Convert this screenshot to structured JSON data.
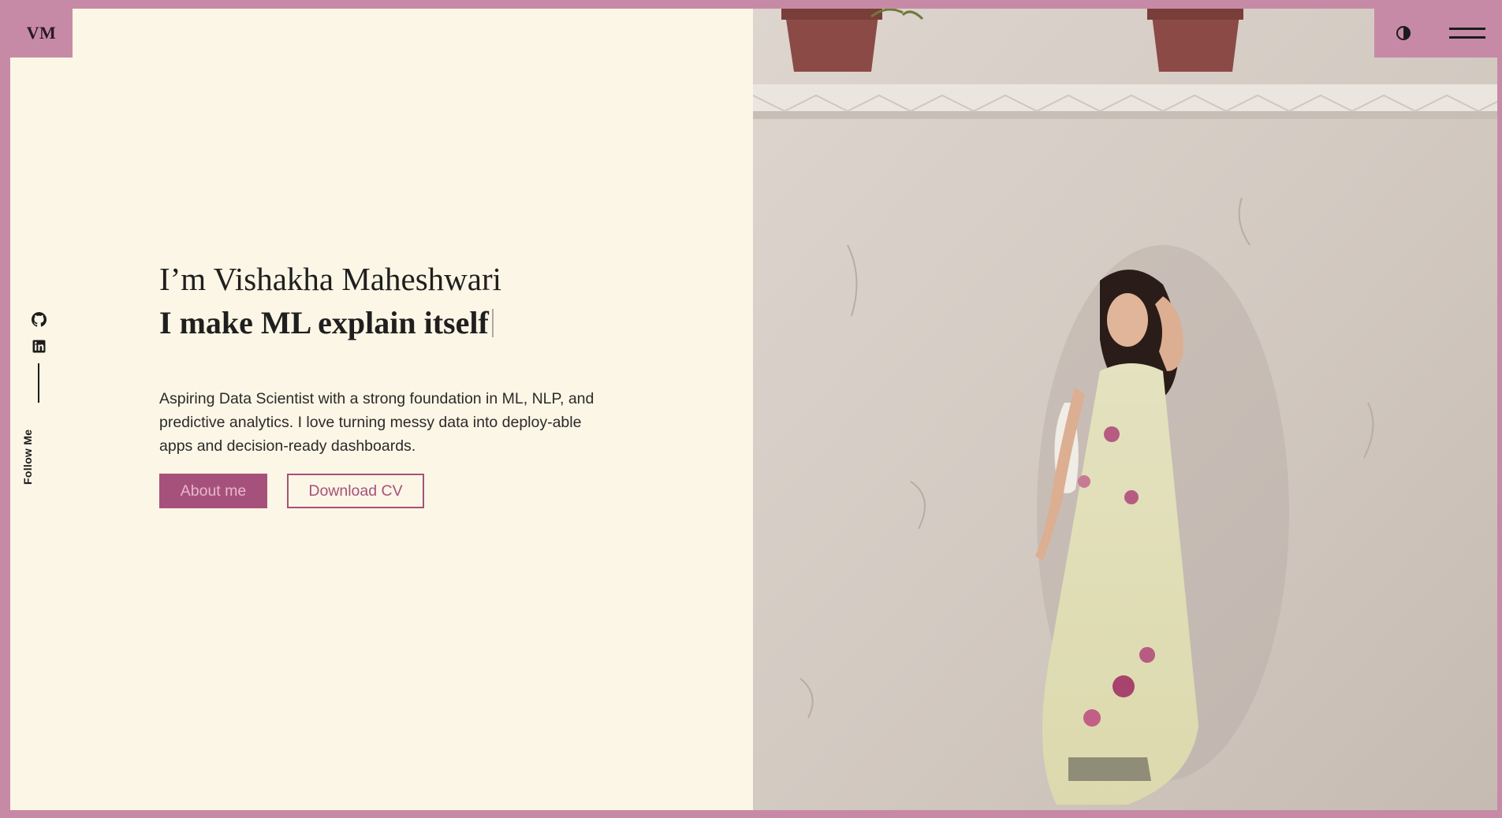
{
  "logo": {
    "text": "VM"
  },
  "social": {
    "items": [
      {
        "name": "GitHub",
        "icon": "github-icon"
      },
      {
        "name": "LinkedIn",
        "icon": "linkedin-icon"
      }
    ],
    "follow_label": "Follow Me"
  },
  "hero": {
    "intro": "I’m Vishakha Maheshwari",
    "tagline": "I make ML explain itself",
    "description": "Aspiring Data Scientist with a strong foundation in ML, NLP, and predictive analytics. I love turning messy data into deploy-able apps and decision-ready dashboards.",
    "about_button": "About me",
    "cv_button": "Download CV"
  },
  "header": {
    "theme_toggle_icon": "contrast-icon",
    "menu_icon": "hamburger-menu-icon"
  },
  "colors": {
    "accent": "#c78aa6",
    "button": "#a6517b",
    "background": "#fcf6e6",
    "text": "#1f1f1f"
  }
}
